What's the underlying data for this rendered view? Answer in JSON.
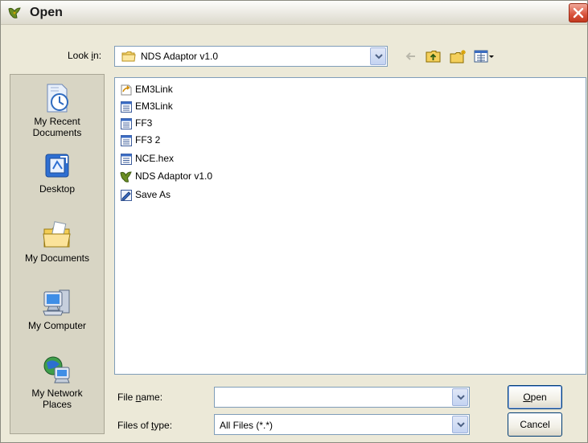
{
  "window": {
    "title": "Open",
    "close_icon": "close-icon"
  },
  "lookin": {
    "label_pre": "Look ",
    "label_u": "i",
    "label_post": "n:",
    "value": "NDS Adaptor v1.0"
  },
  "toolbar": {
    "icons": [
      "back-arrow-icon",
      "up-folder-icon",
      "new-folder-icon",
      "view-menu-icon"
    ]
  },
  "places": [
    {
      "label_line1": "My Recent",
      "label_line2": "Documents",
      "icon": "recent-documents-icon"
    },
    {
      "label_line1": "Desktop",
      "label_line2": "",
      "icon": "desktop-icon"
    },
    {
      "label_line1": "My Documents",
      "label_line2": "",
      "icon": "my-documents-icon"
    },
    {
      "label_line1": "My Computer",
      "label_line2": "",
      "icon": "my-computer-icon"
    },
    {
      "label_line1": "My Network",
      "label_line2": "Places",
      "icon": "network-places-icon"
    }
  ],
  "files": [
    {
      "name": "EM3Link",
      "icon": "shortcut-icon"
    },
    {
      "name": "EM3Link",
      "icon": "document-icon"
    },
    {
      "name": "FF3",
      "icon": "document-icon"
    },
    {
      "name": "FF3 2",
      "icon": "document-icon"
    },
    {
      "name": "NCE.hex",
      "icon": "document-icon"
    },
    {
      "name": "NDS Adaptor v1.0",
      "icon": "app-icon"
    },
    {
      "name": "Save As",
      "icon": "save-as-icon"
    }
  ],
  "filename": {
    "label_pre": "File ",
    "label_u": "n",
    "label_post": "ame:",
    "value": ""
  },
  "filetype": {
    "label_pre": "Files of ",
    "label_u": "t",
    "label_post": "ype:",
    "value": "All Files (*.*)"
  },
  "buttons": {
    "open_u": "O",
    "open_rest": "pen",
    "cancel": "Cancel"
  }
}
